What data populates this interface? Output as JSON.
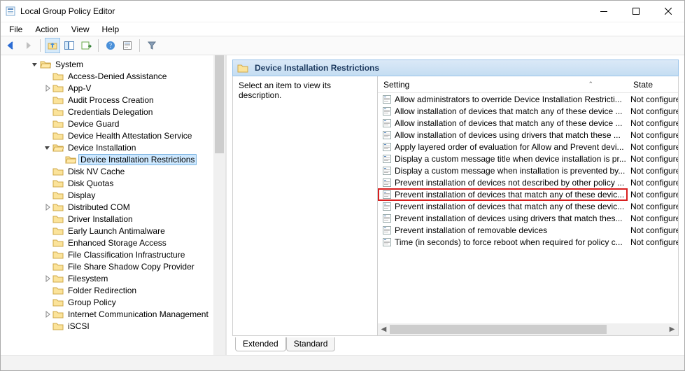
{
  "window": {
    "title": "Local Group Policy Editor"
  },
  "menubar": [
    "File",
    "Action",
    "View",
    "Help"
  ],
  "tree_root": {
    "label": "System",
    "children": [
      {
        "label": "Access-Denied Assistance"
      },
      {
        "label": "App-V",
        "expandable": true
      },
      {
        "label": "Audit Process Creation"
      },
      {
        "label": "Credentials Delegation"
      },
      {
        "label": "Device Guard"
      },
      {
        "label": "Device Health Attestation Service"
      },
      {
        "label": "Device Installation",
        "expandable": true,
        "expanded": true,
        "children": [
          {
            "label": "Device Installation Restrictions",
            "selected": true
          }
        ]
      },
      {
        "label": "Disk NV Cache"
      },
      {
        "label": "Disk Quotas"
      },
      {
        "label": "Display"
      },
      {
        "label": "Distributed COM",
        "expandable": true
      },
      {
        "label": "Driver Installation"
      },
      {
        "label": "Early Launch Antimalware"
      },
      {
        "label": "Enhanced Storage Access"
      },
      {
        "label": "File Classification Infrastructure"
      },
      {
        "label": "File Share Shadow Copy Provider"
      },
      {
        "label": "Filesystem",
        "expandable": true
      },
      {
        "label": "Folder Redirection"
      },
      {
        "label": "Group Policy"
      },
      {
        "label": "Internet Communication Management",
        "expandable": true
      },
      {
        "label": "iSCSI"
      }
    ]
  },
  "right": {
    "header": "Device Installation Restrictions",
    "description_prompt": "Select an item to view its description.",
    "columns": {
      "setting": "Setting",
      "state": "State"
    },
    "rows": [
      {
        "name": "Allow administrators to override Device Installation Restricti...",
        "state": "Not configured"
      },
      {
        "name": "Allow installation of devices that match any of these device ...",
        "state": "Not configured"
      },
      {
        "name": "Allow installation of devices that match any of these device ...",
        "state": "Not configured"
      },
      {
        "name": "Allow installation of devices using drivers that match these ...",
        "state": "Not configured"
      },
      {
        "name": "Apply layered order of evaluation for Allow and Prevent devi...",
        "state": "Not configured"
      },
      {
        "name": "Display a custom message title when device installation is pr...",
        "state": "Not configured"
      },
      {
        "name": "Display a custom message when installation is prevented by...",
        "state": "Not configured"
      },
      {
        "name": "Prevent installation of devices not described by other policy ...",
        "state": "Not configured"
      },
      {
        "name": "Prevent installation of devices that match any of these devic...",
        "state": "Not configured",
        "highlight": true
      },
      {
        "name": "Prevent installation of devices that match any of these devic...",
        "state": "Not configured"
      },
      {
        "name": "Prevent installation of devices using drivers that match thes...",
        "state": "Not configured"
      },
      {
        "name": "Prevent installation of removable devices",
        "state": "Not configured"
      },
      {
        "name": "Time (in seconds) to force reboot when required for policy c...",
        "state": "Not configured"
      }
    ]
  },
  "tabs": [
    "Extended",
    "Standard"
  ]
}
